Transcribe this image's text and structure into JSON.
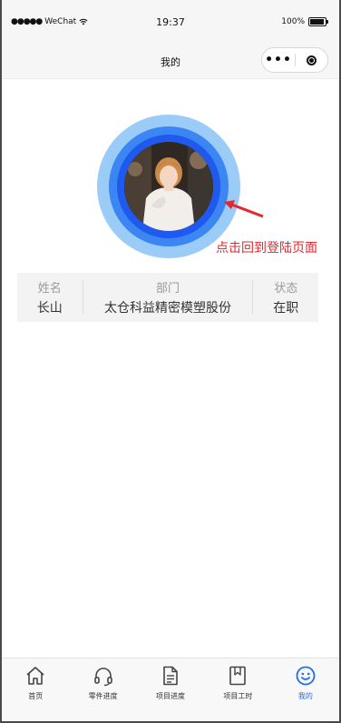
{
  "status_bar": {
    "signal": "●●●●●",
    "carrier": "WeChat",
    "time": "19:37",
    "battery": "100%"
  },
  "nav": {
    "title": "我的",
    "more_label": "•••"
  },
  "avatar": {
    "hint": "点击回到登陆页面",
    "hint_color": "#e8262d",
    "ring_colors": [
      "#9bccf8",
      "#3b86f3",
      "#1f59ee"
    ]
  },
  "info": {
    "columns": [
      {
        "label": "姓名",
        "value": "长山"
      },
      {
        "label": "部门",
        "value": "太仓科益精密模塑股份"
      },
      {
        "label": "状态",
        "value": "在职"
      }
    ]
  },
  "tabbar": {
    "active_color": "#1f6cf5",
    "tabs": [
      {
        "label": "首页",
        "icon": "home-icon"
      },
      {
        "label": "零件进度",
        "icon": "headset-icon"
      },
      {
        "label": "项目进度",
        "icon": "document-icon"
      },
      {
        "label": "项目工时",
        "icon": "bookmark-icon"
      },
      {
        "label": "我的",
        "icon": "smiley-icon",
        "active": true
      }
    ]
  }
}
